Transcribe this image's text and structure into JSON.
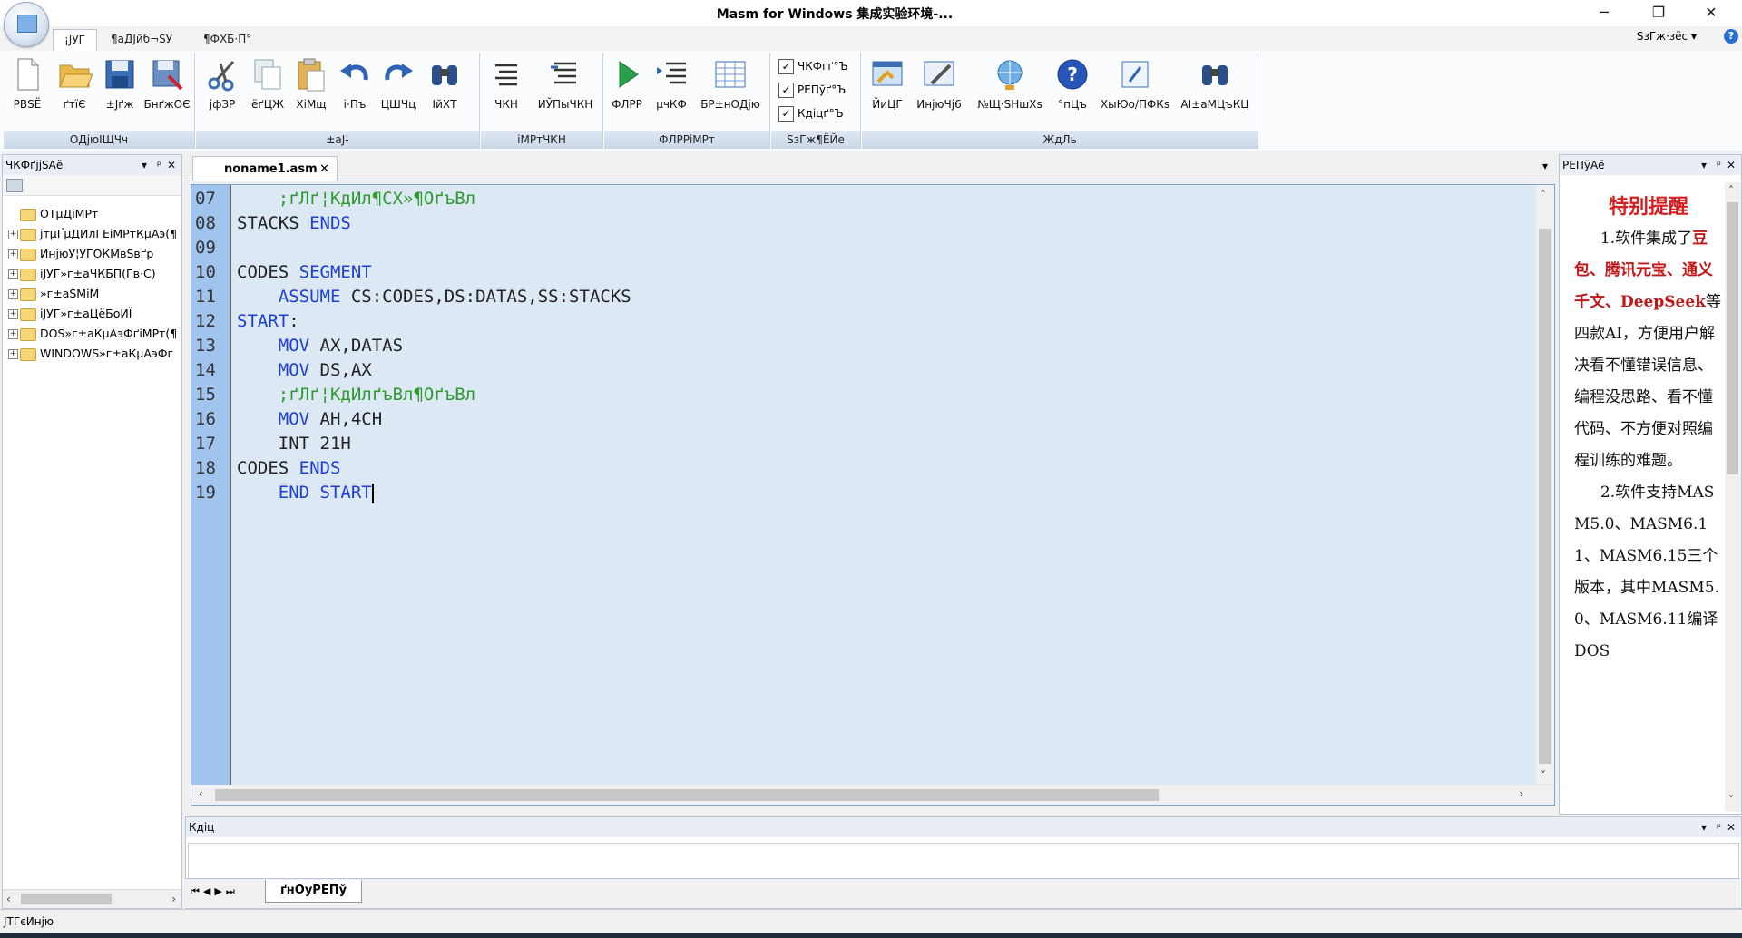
{
  "window": {
    "title": "Masm for Windows 集成实验环境-...",
    "controls": [
      "─",
      "❐",
      "✕"
    ]
  },
  "menu_tabs": [
    "¡ЈУГ",
    "¶аДЈйб¬SУ",
    "¶ФХБ·П°"
  ],
  "style_menu": "SзГж·зёс",
  "ribbon": {
    "groups": [
      {
        "label": "ОДјюІЩЧч",
        "buttons": [
          "РВЅЁ",
          "ґтїЄ",
          "±Јґж",
          "БнґжОЄ"
        ]
      },
      {
        "label": "±аЈ-",
        "buttons": [
          "јфЗР",
          "ёґЦЖ",
          "ХіМщ",
          "і·Пъ",
          "ЦШЧц",
          "ІйХТ"
        ]
      },
      {
        "label": "іМРтЧКН",
        "buttons": [
          "ЧКН",
          "ИЎПыЧКН"
        ]
      },
      {
        "label": "ФЛРРіМРт",
        "buttons": [
          "ФЛРР",
          "µчКФ",
          "БР±нОДјю"
        ]
      },
      {
        "label": "SзГж¶ЁЙе",
        "checkboxes": [
          "ЧКФґґ°Ъ",
          "РЕПўґ°Ъ",
          "Кдіцґ°Ъ"
        ]
      },
      {
        "label": "ЖдЛь",
        "buttons": [
          "ЙиЦГ",
          "ИнјюЧј6",
          "№Щ·SНшХѕ",
          "°пЦъ",
          "ХыЮо/ПФКѕ",
          "AI±аМЦъКЦ"
        ]
      }
    ]
  },
  "left_pane": {
    "title": "ЧКФґјјSАё",
    "items": [
      {
        "label": "ОТµДіМРт",
        "expandable": false
      },
      {
        "label": "јтµҐµДИлГЕіМРтКµАэ(¶",
        "expandable": true
      },
      {
        "label": "ИнјюУ¦УГОКМвЅвґр",
        "expandable": true
      },
      {
        "label": "іЈУГ»г±аЧКБП(Гв·С)",
        "expandable": true
      },
      {
        "label": "»г±аSМіМ",
        "expandable": true
      },
      {
        "label": "іЈУГ»г±аЦёБоИЇ",
        "expandable": true
      },
      {
        "label": "DOS»г±аКµАэФґіМРт(¶",
        "expandable": true
      },
      {
        "label": "WINDOWS»г±аКµАэФг",
        "expandable": true
      }
    ]
  },
  "editor": {
    "tab": "noname1.asm",
    "lines": [
      {
        "n": "07",
        "parts": [
          {
            "t": "    ;ґЛґ¦КдИл¶СХ»¶ОґъВл",
            "c": "cm"
          }
        ]
      },
      {
        "n": "08",
        "parts": [
          {
            "t": "STACKS ",
            "c": "tx"
          },
          {
            "t": "ENDS",
            "c": "kw"
          }
        ]
      },
      {
        "n": "09",
        "parts": []
      },
      {
        "n": "10",
        "parts": [
          {
            "t": "CODES ",
            "c": "tx"
          },
          {
            "t": "SEGMENT",
            "c": "kw"
          }
        ]
      },
      {
        "n": "11",
        "parts": [
          {
            "t": "    ASSUME ",
            "c": "kw"
          },
          {
            "t": "CS:CODES,DS:DATAS,SS:STACKS",
            "c": "tx"
          }
        ]
      },
      {
        "n": "12",
        "parts": [
          {
            "t": "START",
            "c": "kw"
          },
          {
            "t": ":",
            "c": "tx"
          }
        ]
      },
      {
        "n": "13",
        "parts": [
          {
            "t": "    MOV ",
            "c": "kw"
          },
          {
            "t": "AX,DATAS",
            "c": "tx"
          }
        ]
      },
      {
        "n": "14",
        "parts": [
          {
            "t": "    MOV ",
            "c": "kw"
          },
          {
            "t": "DS,AX",
            "c": "tx"
          }
        ]
      },
      {
        "n": "15",
        "parts": [
          {
            "t": "    ;ґЛґ¦КдИлґъВл¶ОґъВл",
            "c": "cm"
          }
        ]
      },
      {
        "n": "16",
        "parts": [
          {
            "t": "    MOV ",
            "c": "kw"
          },
          {
            "t": "AH,4CH",
            "c": "tx"
          }
        ]
      },
      {
        "n": "17",
        "parts": [
          {
            "t": "    INT 21H",
            "c": "tx"
          }
        ]
      },
      {
        "n": "18",
        "parts": [
          {
            "t": "CODES ",
            "c": "tx"
          },
          {
            "t": "ENDS",
            "c": "kw"
          }
        ]
      },
      {
        "n": "19",
        "parts": [
          {
            "t": "    END ",
            "c": "kw"
          },
          {
            "t": "START",
            "c": "kw"
          }
        ],
        "caret": true
      }
    ]
  },
  "output_pane": {
    "title": "Кдіц",
    "tab": "ґнОуРЕПў",
    "nav": [
      "⏮",
      "◀",
      "▶",
      "⏭"
    ]
  },
  "right_pane": {
    "title": "РЕПўАё",
    "heading": "特别提醒",
    "p1_pre": "1.软件集成了",
    "p1_red": "豆包、腾讯元宝、通义千文、DeepSeek",
    "p1_post": "等四款AI，方便用户解决看不懂错误信息、编程没思路、看不懂代码、不方便对照编程训练的难题。",
    "p2": "2.软件支持MASM5.0、MASM6.11、MASM6.15三个版本，其中MASM5.0、MASM6.11编译DOS"
  },
  "status": "ЈТГєИнјю",
  "colors": {
    "keyword": "#1d3fd6",
    "comment": "#2f9a2f",
    "gutter": "#a1c4ef",
    "editor_bg": "#dce8f3",
    "reminder_red": "#d42020"
  }
}
